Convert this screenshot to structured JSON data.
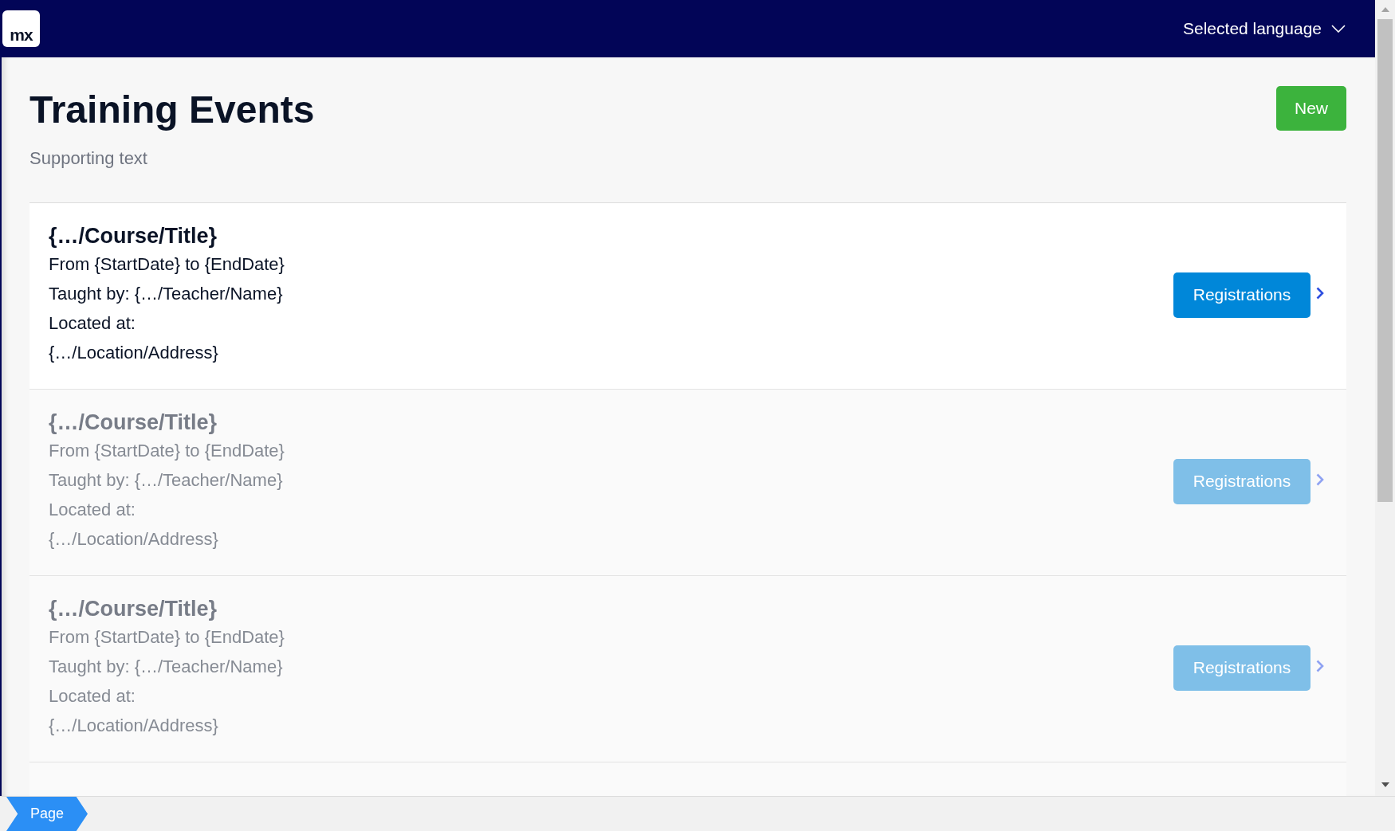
{
  "top_bar": {
    "logo": "mx",
    "language_menu": "Selected language"
  },
  "header": {
    "title": "Training Events",
    "subtitle": "Supporting text",
    "new_button": "New"
  },
  "events": [
    {
      "title": "{…/Course/Title}",
      "dates": "From {StartDate} to {EndDate}",
      "teacher": "Taught by: {…/Teacher/Name}",
      "location_label": "Located at:",
      "address": "{…/Location/Address}",
      "button": "Registrations",
      "disabled": false
    },
    {
      "title": "{…/Course/Title}",
      "dates": "From {StartDate} to {EndDate}",
      "teacher": "Taught by: {…/Teacher/Name}",
      "location_label": "Located at:",
      "address": "{…/Location/Address}",
      "button": "Registrations",
      "disabled": true
    },
    {
      "title": "{…/Course/Title}",
      "dates": "From {StartDate} to {EndDate}",
      "teacher": "Taught by: {…/Teacher/Name}",
      "location_label": "Located at:",
      "address": "{…/Location/Address}",
      "button": "Registrations",
      "disabled": true
    }
  ],
  "breadcrumb": {
    "label": "Page"
  }
}
